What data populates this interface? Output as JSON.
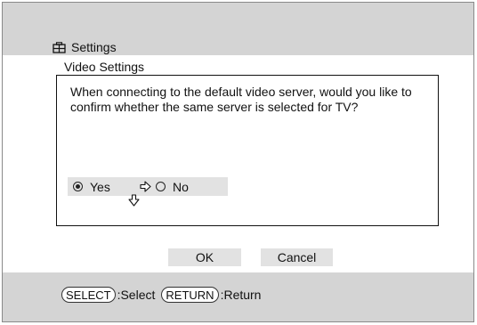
{
  "header": {
    "title": "Settings",
    "icon": "settings-icon"
  },
  "subheading": "Video Settings",
  "dialog": {
    "prompt": "When connecting to the default video server, would you like to confirm whether the same server is selected for TV?",
    "options": {
      "yes": {
        "label": "Yes",
        "selected": true
      },
      "no": {
        "label": "No",
        "selected": false
      }
    },
    "cursor_icons": [
      "arrow-right-icon",
      "arrow-down-icon"
    ]
  },
  "buttons": {
    "ok": "OK",
    "cancel": "Cancel"
  },
  "footer": {
    "select_key": "SELECT",
    "select_label": ":Select",
    "return_key": "RETURN",
    "return_label": ":Return"
  },
  "colors": {
    "band_gray": "#d4d4d4",
    "highlight_gray": "#e2e2e2",
    "text": "#111111"
  }
}
